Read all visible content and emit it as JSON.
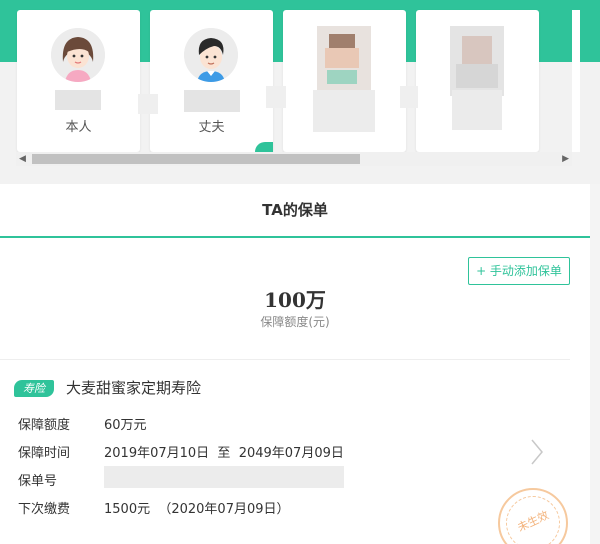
{
  "members": [
    {
      "label": "本人",
      "avatar": "female-avatar-icon",
      "active": false
    },
    {
      "label": "丈夫",
      "avatar": "male-avatar-icon",
      "active": true
    },
    {
      "label": "",
      "avatar": "blurred-avatar",
      "active": false
    },
    {
      "label": "",
      "avatar": "blurred-avatar",
      "active": false
    }
  ],
  "section": {
    "title": "TA的保单"
  },
  "actions": {
    "add_policy": "+ 手动添加保单"
  },
  "summary": {
    "total": "100万",
    "total_label": "保障额度(元)"
  },
  "policy": {
    "tag": "寿险",
    "name": "大麦甜蜜家定期寿险",
    "rows": [
      {
        "key": "保障额度",
        "value": "60万元"
      },
      {
        "key": "保障时间",
        "value": "2019年07月10日  至  2049年07月09日"
      },
      {
        "key": "保单号",
        "value": ""
      },
      {
        "key": "下次缴费",
        "value": "1500元  （2020年07月09日）"
      }
    ],
    "stamp": "未生效"
  },
  "colors": {
    "accent": "#2fc39a",
    "stamp": "#f3b27a"
  }
}
